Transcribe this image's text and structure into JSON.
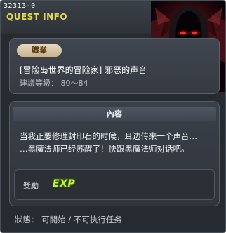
{
  "quest": {
    "id": "32313-0",
    "panel_title": "QUEST INFO",
    "portrait_icon": "dark-mage-portrait-icon",
    "job_tag": "職業",
    "title": "[冒险岛世界的冒险家] 邪恶的声音",
    "level_text": "建議等級： 80～84"
  },
  "content": {
    "header": "內容",
    "lines": [
      "当我正要修理封印石的时候，耳边传来一个声音…",
      "…黑魔法师已经苏醒了！快跟黑魔法师对话吧。"
    ]
  },
  "reward": {
    "label": "獎勵",
    "exp_label": "EXP",
    "exp_icon": "exp-icon"
  },
  "status": {
    "text": "狀態： 可開始 / 不可执行任务"
  },
  "colors": {
    "accent_yellow": "#e7d84a",
    "job_tag_bg": "#d8c6a6",
    "exp_green": "#c8f030",
    "panel_bg": "#262b31"
  }
}
